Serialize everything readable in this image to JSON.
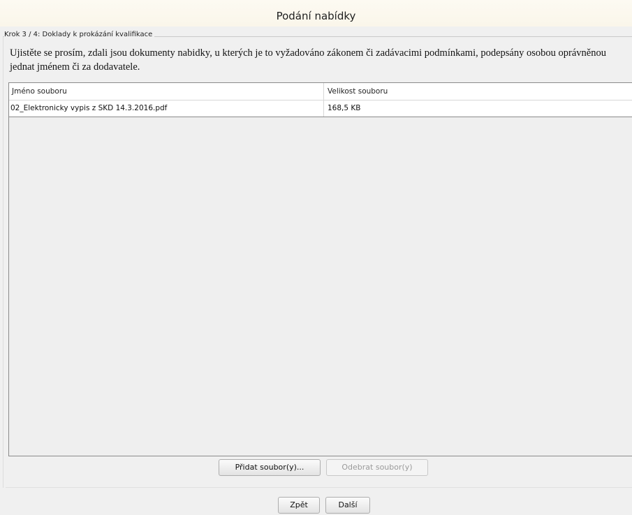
{
  "window": {
    "title": "Podání nabídky"
  },
  "step": {
    "label": "Krok 3 / 4: Doklady k prokázání kvalifikace"
  },
  "info": {
    "text": "Ujistěte se prosím, zdali jsou dokumenty nabidky, u kterých je to vyžadováno zákonem či zadávacimi podmínkami, podepsány osobou oprávněnou jednat jménem či za dodavatele."
  },
  "table": {
    "columns": [
      "Jméno souboru",
      "Velikost souboru"
    ],
    "rows": [
      [
        "02_Elektronicky vypis z SKD 14.3.2016.pdf",
        "168,5 KB"
      ]
    ]
  },
  "actions": {
    "add_files": "Přidat soubor(y)...",
    "remove_files": "Odebrat soubor(y)"
  },
  "navigation": {
    "back": "Zpět",
    "next": "Další"
  }
}
